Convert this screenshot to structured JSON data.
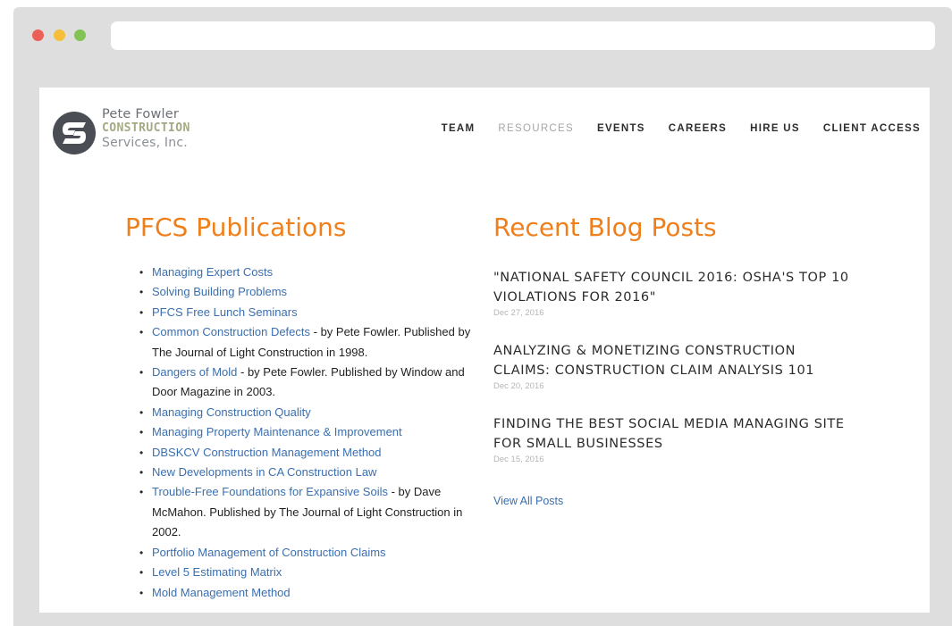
{
  "browser": {
    "address": ""
  },
  "logo": {
    "line1": "Pete Fowler",
    "line2": "CONSTRUCTION",
    "line3": "Services, Inc."
  },
  "nav": {
    "items": [
      {
        "label": "TEAM"
      },
      {
        "label": "RESOURCES"
      },
      {
        "label": "EVENTS"
      },
      {
        "label": "CAREERS"
      },
      {
        "label": "HIRE US"
      },
      {
        "label": "CLIENT ACCESS"
      }
    ]
  },
  "publications": {
    "title": "PFCS Publications",
    "items": [
      {
        "link": "Managing Expert Costs",
        "desc": ""
      },
      {
        "link": "Solving Building Problems",
        "desc": ""
      },
      {
        "link": "PFCS Free Lunch Seminars",
        "desc": ""
      },
      {
        "link": "Common Construction Defects",
        "desc": " - by Pete Fowler. Published by The Journal of Light Construction in 1998."
      },
      {
        "link": "Dangers of Mold",
        "desc": " - by Pete Fowler. Published by Window and Door Magazine in 2003."
      },
      {
        "link": "Managing Construction Quality",
        "desc": ""
      },
      {
        "link": "Managing Property Maintenance & Improvement",
        "desc": ""
      },
      {
        "link": "DBSKCV Construction Management Method",
        "desc": ""
      },
      {
        "link": "New Developments in CA Construction Law",
        "desc": ""
      },
      {
        "link": "Trouble-Free Foundations for Expansive Soils",
        "desc": " - by Dave McMahon. Published by The Journal of Light Construction in 2002."
      },
      {
        "link": "Portfolio Management of Construction Claims",
        "desc": ""
      },
      {
        "link": "Level 5 Estimating Matrix",
        "desc": ""
      },
      {
        "link": "Mold Management Method",
        "desc": ""
      }
    ]
  },
  "blog": {
    "title": "Recent Blog Posts",
    "posts": [
      {
        "title": "\"NATIONAL SAFETY COUNCIL 2016: OSHA'S TOP 10 VIOLATIONS FOR 2016\"",
        "date": "Dec 27, 2016"
      },
      {
        "title": "ANALYZING & MONETIZING CONSTRUCTION CLAIMS: CONSTRUCTION CLAIM ANALYSIS 101",
        "date": "Dec 20, 2016"
      },
      {
        "title": "FINDING THE BEST SOCIAL MEDIA MANAGING SITE FOR SMALL BUSINESSES",
        "date": "Dec 15, 2016"
      }
    ],
    "view_all": "View All Posts"
  },
  "colors": {
    "accent_orange": "#ef7f1a",
    "link_blue": "#3a6fb0",
    "nav_active_muted": "#a6a6a6"
  }
}
